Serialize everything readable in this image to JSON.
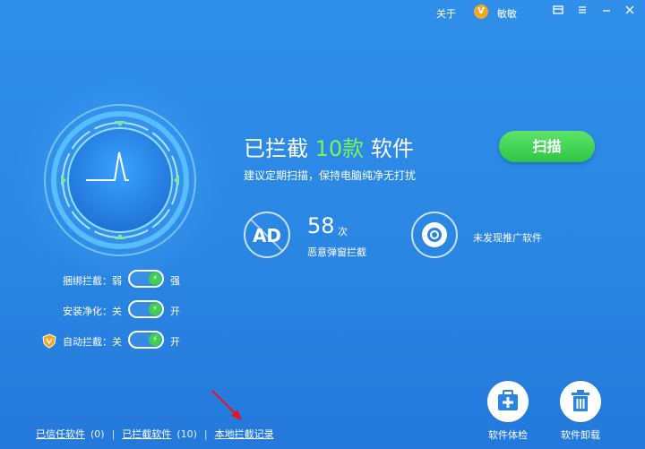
{
  "titlebar": {
    "about_label": "关于",
    "user_badge": "V",
    "username": "敏敏",
    "icons": [
      "feedback-icon",
      "menu-icon",
      "minimize-icon",
      "close-icon"
    ]
  },
  "status": {
    "prefix": "已拦截 ",
    "count": "10款",
    "suffix": " 软件",
    "subtitle": "建议定期扫描，保持电脑纯净无打扰",
    "scan_button": "扫描"
  },
  "stats": {
    "ad_icon_text": "AD",
    "popup_count": "58",
    "popup_unit": "次",
    "popup_label": "恶意弹窗拦截",
    "promo_label": "未发现推广软件"
  },
  "toggles": [
    {
      "label": "捆绑拦截：弱",
      "state": "强",
      "on": true
    },
    {
      "label": "安装净化：关",
      "state": "开",
      "on": true
    },
    {
      "label": "自动拦截：关",
      "state": "开",
      "on": true
    }
  ],
  "bottom_links": {
    "trusted": "已信任软件",
    "trusted_count": "(0)",
    "blocked": "已拦截软件",
    "blocked_count": "(10)",
    "sep": "|",
    "local_records": "本地拦截记录"
  },
  "tools": {
    "checkup_label": "软件体检",
    "uninstall_label": "软件卸载"
  },
  "colors": {
    "background": "#2a86e3",
    "accent_green": "#7ef35a",
    "button_green": "#3ecf4f",
    "badge_orange": "#f5a623",
    "annotation_red": "#e8101a"
  }
}
